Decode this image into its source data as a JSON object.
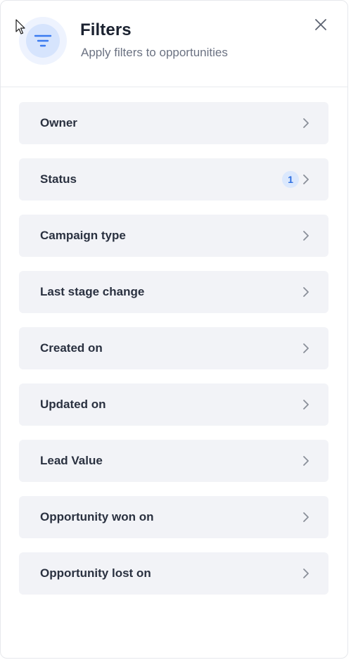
{
  "header": {
    "title": "Filters",
    "subtitle": "Apply filters to opportunities",
    "icon": "filter-icon",
    "close_icon": "close-icon"
  },
  "filters": [
    {
      "label": "Owner"
    },
    {
      "label": "Status",
      "badge": "1"
    },
    {
      "label": "Campaign type"
    },
    {
      "label": "Last stage change"
    },
    {
      "label": "Created on"
    },
    {
      "label": "Updated on"
    },
    {
      "label": "Lead Value"
    },
    {
      "label": "Opportunity won on"
    },
    {
      "label": "Opportunity lost on"
    }
  ],
  "colors": {
    "accent": "#3b7bf0",
    "item_bg": "#f2f3f7",
    "badge_bg": "#dbe8fd",
    "badge_text": "#2f6fe0"
  }
}
